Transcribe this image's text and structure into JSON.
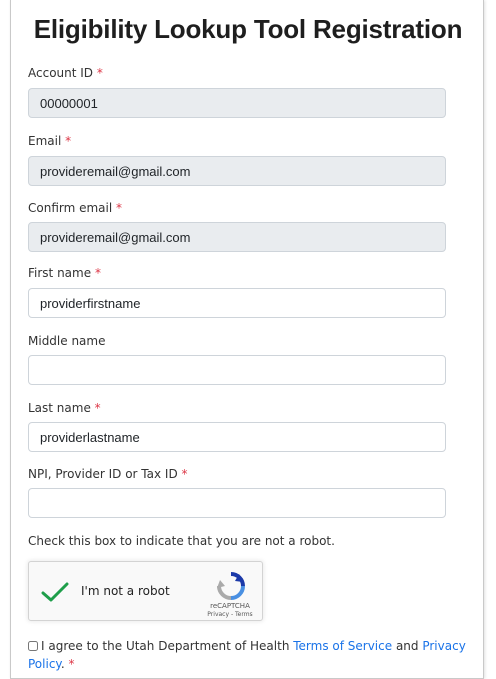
{
  "page_title": "Eligibility Lookup Tool Registration",
  "required_marker": "*",
  "fields": {
    "account_id": {
      "label": "Account ID",
      "value": "00000001"
    },
    "email": {
      "label": "Email",
      "value": "provideremail@gmail.com"
    },
    "confirm_email": {
      "label": "Confirm email",
      "value": "provideremail@gmail.com"
    },
    "first_name": {
      "label": "First name",
      "value": "providerfirstname"
    },
    "middle_name": {
      "label": "Middle name",
      "value": ""
    },
    "last_name": {
      "label": "Last name",
      "value": "providerlastname"
    },
    "npi": {
      "label": "NPI, Provider ID or Tax ID",
      "value": ""
    }
  },
  "robot_instruction": "Check this box to indicate that you are not a robot.",
  "captcha": {
    "label": "I'm not a robot",
    "brand": "reCAPTCHA",
    "privacy": "Privacy",
    "separator": " - ",
    "terms": "Terms"
  },
  "agreement": {
    "prefix": "I agree to the Utah Department of Health ",
    "terms_link": "Terms of Service",
    "middle": " and ",
    "privacy_link": "Privacy Policy",
    "suffix": "."
  },
  "colors": {
    "required": "#dc3545",
    "link": "#1a73e8",
    "readonly_bg": "#e9ecef",
    "checkmark": "#1e9e4a"
  }
}
